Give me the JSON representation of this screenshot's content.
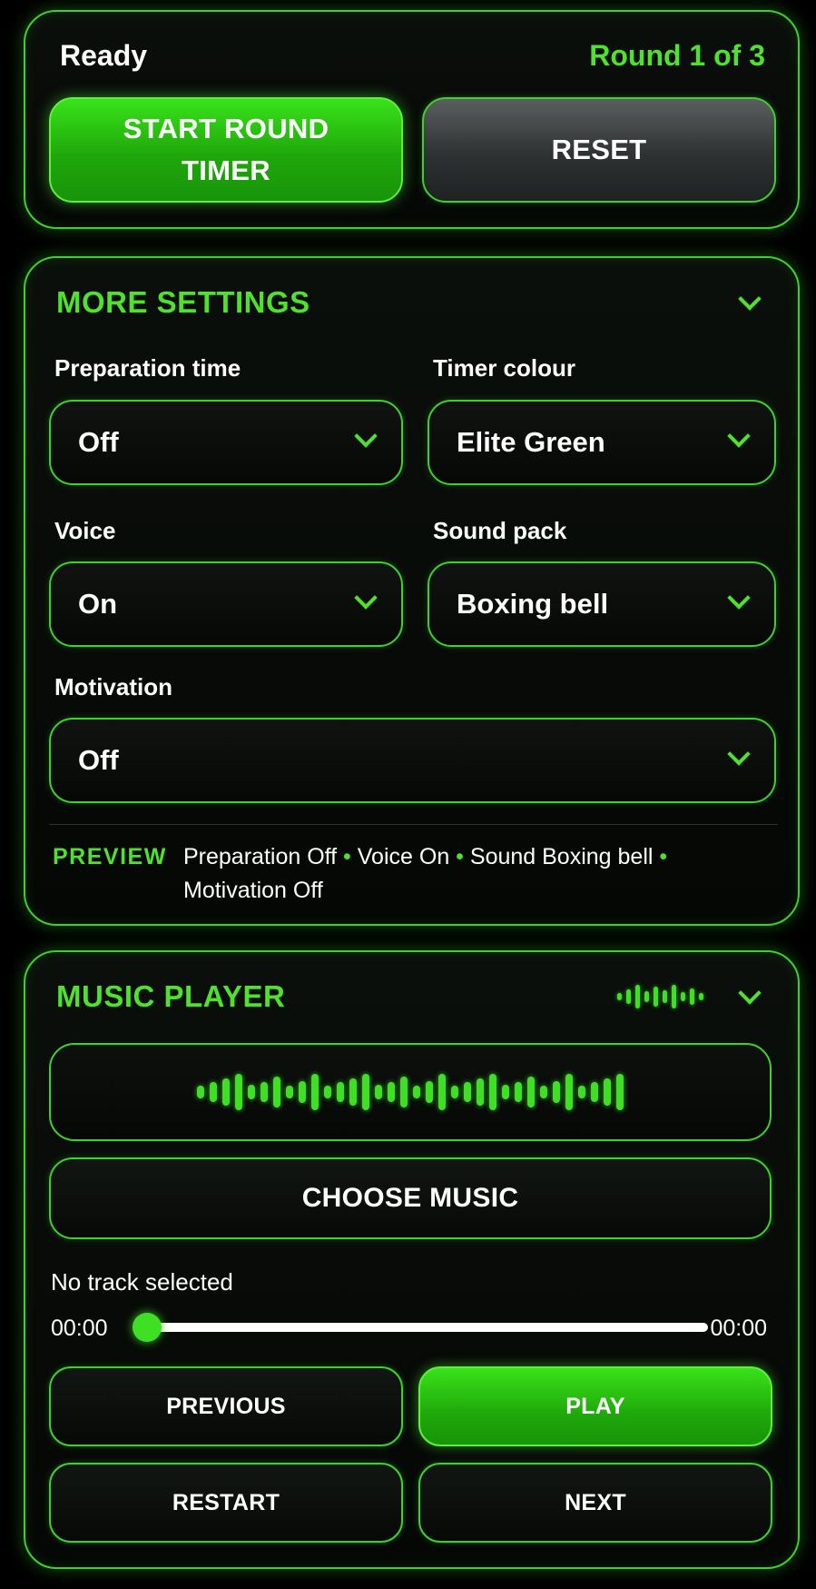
{
  "timer": {
    "status": "Ready",
    "round_label": "Round 1 of 3",
    "start_label_line1": "START ROUND",
    "start_label_line2": "TIMER",
    "reset_label": "RESET"
  },
  "settings": {
    "title": "MORE SETTINGS",
    "preparation": {
      "label": "Preparation time",
      "value": "Off"
    },
    "timer_colour": {
      "label": "Timer colour",
      "value": "Elite Green"
    },
    "voice": {
      "label": "Voice",
      "value": "On"
    },
    "sound_pack": {
      "label": "Sound pack",
      "value": "Boxing bell"
    },
    "motivation": {
      "label": "Motivation",
      "value": "Off"
    },
    "preview": {
      "label": "PREVIEW",
      "part1": "Preparation Off",
      "part2": "Voice On",
      "part3": "Sound Boxing bell",
      "part4": "Motivation Off",
      "separator": "•"
    }
  },
  "music": {
    "title": "MUSIC PLAYER",
    "choose_label": "CHOOSE MUSIC",
    "track": "No track selected",
    "time_current": "00:00",
    "time_total": "00:00",
    "progress": 0,
    "previous_label": "PREVIOUS",
    "play_label": "PLAY",
    "restart_label": "RESTART",
    "next_label": "NEXT"
  },
  "icons": {
    "collapse": "chevron-down-icon",
    "dropdown": "chevron-down-icon",
    "waveform": "waveform-icon"
  },
  "colors": {
    "accent": "#4fe12d",
    "background": "#000000",
    "reset_button": "#2e3232"
  }
}
